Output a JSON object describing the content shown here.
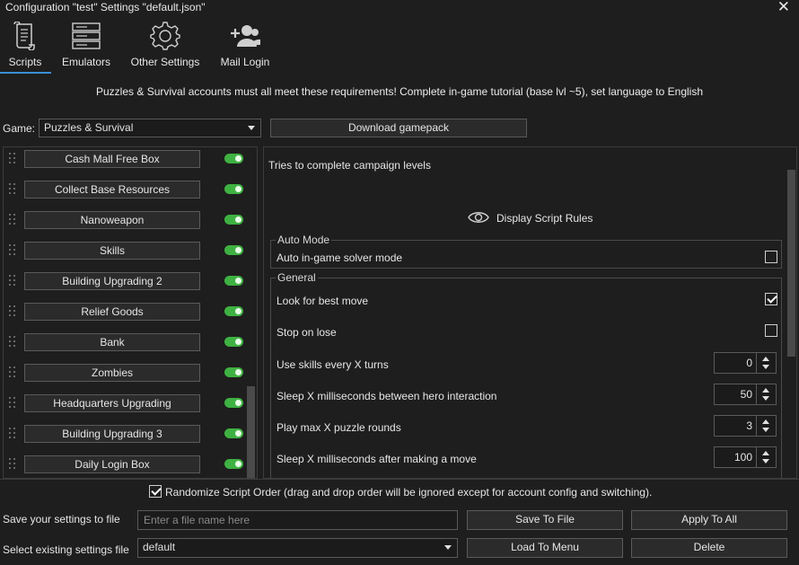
{
  "window": {
    "title": "Configuration \"test\" Settings \"default.json\"",
    "close_glyph": "✕"
  },
  "tabs": [
    {
      "label": "Scripts",
      "icon": "scroll-icon",
      "active": true
    },
    {
      "label": "Emulators",
      "icon": "server-icon"
    },
    {
      "label": "Other Settings",
      "icon": "gear-icon"
    },
    {
      "label": "Mail Login",
      "icon": "user-add-icon"
    }
  ],
  "notice": "Puzzles & Survival accounts must all meet these requirements! Complete in-game tutorial (base lvl ~5), set language to English",
  "game": {
    "label": "Game:",
    "selected": "Puzzles & Survival",
    "download_label": "Download gamepack"
  },
  "scripts": [
    {
      "label": "Cash Mall Free Box",
      "enabled": true
    },
    {
      "label": "Collect Base Resources",
      "enabled": true
    },
    {
      "label": "Nanoweapon",
      "enabled": true
    },
    {
      "label": "Skills",
      "enabled": true
    },
    {
      "label": "Building Upgrading 2",
      "enabled": true
    },
    {
      "label": "Relief Goods",
      "enabled": true
    },
    {
      "label": "Bank",
      "enabled": true
    },
    {
      "label": "Zombies",
      "enabled": true
    },
    {
      "label": "Headquarters Upgrading",
      "enabled": true
    },
    {
      "label": "Building Upgrading 3",
      "enabled": true
    },
    {
      "label": "Daily Login Box",
      "enabled": true
    }
  ],
  "details": {
    "description": "Tries to complete campaign levels",
    "display_rules_label": "Display Script Rules",
    "auto_mode": {
      "title": "Auto Mode",
      "solver_label": "Auto in-game solver mode",
      "solver_checked": false
    },
    "general": {
      "title": "General",
      "best_move_label": "Look for best move",
      "best_move_checked": true,
      "stop_on_lose_label": "Stop on lose",
      "stop_on_lose_checked": false,
      "skills_label": "Use skills every X turns",
      "skills_value": "0",
      "sleep_hero_label": "Sleep X milliseconds between hero interaction",
      "sleep_hero_value": "50",
      "max_rounds_label": "Play max X puzzle rounds",
      "max_rounds_value": "3",
      "sleep_move_label": "Sleep X milliseconds after making a move",
      "sleep_move_value": "100"
    }
  },
  "randomize": {
    "label": "Randomize Script Order (drag and drop order will be ignored except for account config and switching).",
    "checked": true
  },
  "save": {
    "label": "Save your settings to file",
    "placeholder": "Enter a file name here",
    "save_button": "Save To File",
    "apply_button": "Apply To All"
  },
  "load": {
    "label": "Select existing settings file",
    "selected": "default",
    "load_button": "Load To Menu",
    "delete_button": "Delete"
  },
  "colors": {
    "accent": "#3a8fd8",
    "toggle_on": "#3fb142",
    "background": "#1e1e1e"
  }
}
